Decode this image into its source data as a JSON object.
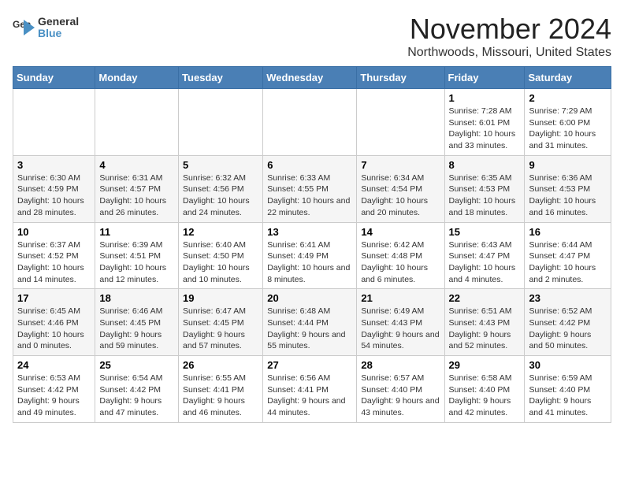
{
  "logo": {
    "text_general": "General",
    "text_blue": "Blue"
  },
  "header": {
    "month": "November 2024",
    "location": "Northwoods, Missouri, United States"
  },
  "weekdays": [
    "Sunday",
    "Monday",
    "Tuesday",
    "Wednesday",
    "Thursday",
    "Friday",
    "Saturday"
  ],
  "weeks": [
    [
      {
        "day": "",
        "info": ""
      },
      {
        "day": "",
        "info": ""
      },
      {
        "day": "",
        "info": ""
      },
      {
        "day": "",
        "info": ""
      },
      {
        "day": "",
        "info": ""
      },
      {
        "day": "1",
        "info": "Sunrise: 7:28 AM\nSunset: 6:01 PM\nDaylight: 10 hours and 33 minutes."
      },
      {
        "day": "2",
        "info": "Sunrise: 7:29 AM\nSunset: 6:00 PM\nDaylight: 10 hours and 31 minutes."
      }
    ],
    [
      {
        "day": "3",
        "info": "Sunrise: 6:30 AM\nSunset: 4:59 PM\nDaylight: 10 hours and 28 minutes."
      },
      {
        "day": "4",
        "info": "Sunrise: 6:31 AM\nSunset: 4:57 PM\nDaylight: 10 hours and 26 minutes."
      },
      {
        "day": "5",
        "info": "Sunrise: 6:32 AM\nSunset: 4:56 PM\nDaylight: 10 hours and 24 minutes."
      },
      {
        "day": "6",
        "info": "Sunrise: 6:33 AM\nSunset: 4:55 PM\nDaylight: 10 hours and 22 minutes."
      },
      {
        "day": "7",
        "info": "Sunrise: 6:34 AM\nSunset: 4:54 PM\nDaylight: 10 hours and 20 minutes."
      },
      {
        "day": "8",
        "info": "Sunrise: 6:35 AM\nSunset: 4:53 PM\nDaylight: 10 hours and 18 minutes."
      },
      {
        "day": "9",
        "info": "Sunrise: 6:36 AM\nSunset: 4:53 PM\nDaylight: 10 hours and 16 minutes."
      }
    ],
    [
      {
        "day": "10",
        "info": "Sunrise: 6:37 AM\nSunset: 4:52 PM\nDaylight: 10 hours and 14 minutes."
      },
      {
        "day": "11",
        "info": "Sunrise: 6:39 AM\nSunset: 4:51 PM\nDaylight: 10 hours and 12 minutes."
      },
      {
        "day": "12",
        "info": "Sunrise: 6:40 AM\nSunset: 4:50 PM\nDaylight: 10 hours and 10 minutes."
      },
      {
        "day": "13",
        "info": "Sunrise: 6:41 AM\nSunset: 4:49 PM\nDaylight: 10 hours and 8 minutes."
      },
      {
        "day": "14",
        "info": "Sunrise: 6:42 AM\nSunset: 4:48 PM\nDaylight: 10 hours and 6 minutes."
      },
      {
        "day": "15",
        "info": "Sunrise: 6:43 AM\nSunset: 4:47 PM\nDaylight: 10 hours and 4 minutes."
      },
      {
        "day": "16",
        "info": "Sunrise: 6:44 AM\nSunset: 4:47 PM\nDaylight: 10 hours and 2 minutes."
      }
    ],
    [
      {
        "day": "17",
        "info": "Sunrise: 6:45 AM\nSunset: 4:46 PM\nDaylight: 10 hours and 0 minutes."
      },
      {
        "day": "18",
        "info": "Sunrise: 6:46 AM\nSunset: 4:45 PM\nDaylight: 9 hours and 59 minutes."
      },
      {
        "day": "19",
        "info": "Sunrise: 6:47 AM\nSunset: 4:45 PM\nDaylight: 9 hours and 57 minutes."
      },
      {
        "day": "20",
        "info": "Sunrise: 6:48 AM\nSunset: 4:44 PM\nDaylight: 9 hours and 55 minutes."
      },
      {
        "day": "21",
        "info": "Sunrise: 6:49 AM\nSunset: 4:43 PM\nDaylight: 9 hours and 54 minutes."
      },
      {
        "day": "22",
        "info": "Sunrise: 6:51 AM\nSunset: 4:43 PM\nDaylight: 9 hours and 52 minutes."
      },
      {
        "day": "23",
        "info": "Sunrise: 6:52 AM\nSunset: 4:42 PM\nDaylight: 9 hours and 50 minutes."
      }
    ],
    [
      {
        "day": "24",
        "info": "Sunrise: 6:53 AM\nSunset: 4:42 PM\nDaylight: 9 hours and 49 minutes."
      },
      {
        "day": "25",
        "info": "Sunrise: 6:54 AM\nSunset: 4:42 PM\nDaylight: 9 hours and 47 minutes."
      },
      {
        "day": "26",
        "info": "Sunrise: 6:55 AM\nSunset: 4:41 PM\nDaylight: 9 hours and 46 minutes."
      },
      {
        "day": "27",
        "info": "Sunrise: 6:56 AM\nSunset: 4:41 PM\nDaylight: 9 hours and 44 minutes."
      },
      {
        "day": "28",
        "info": "Sunrise: 6:57 AM\nSunset: 4:40 PM\nDaylight: 9 hours and 43 minutes."
      },
      {
        "day": "29",
        "info": "Sunrise: 6:58 AM\nSunset: 4:40 PM\nDaylight: 9 hours and 42 minutes."
      },
      {
        "day": "30",
        "info": "Sunrise: 6:59 AM\nSunset: 4:40 PM\nDaylight: 9 hours and 41 minutes."
      }
    ]
  ]
}
